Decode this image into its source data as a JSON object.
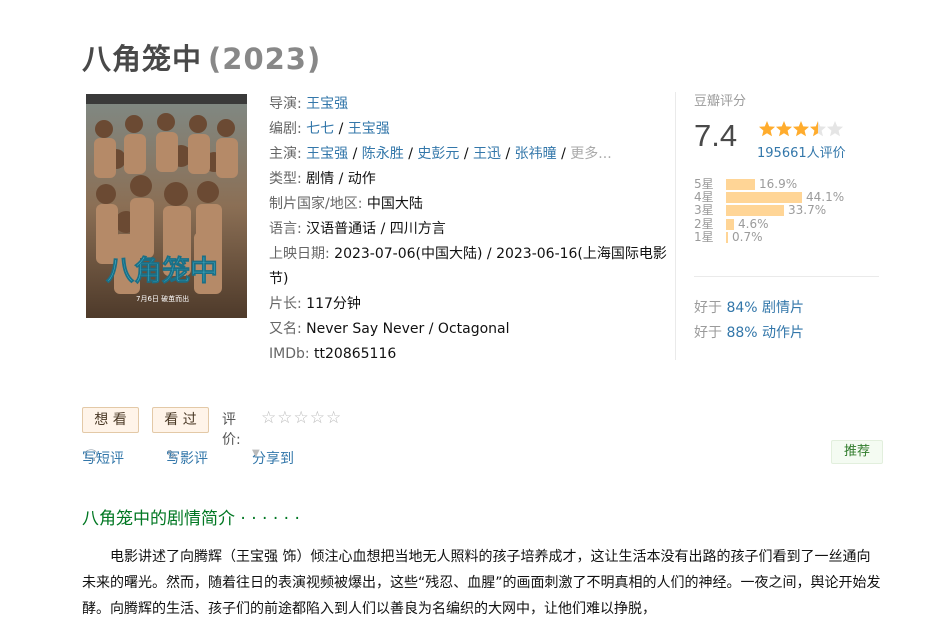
{
  "movie": {
    "title": "八角笼中",
    "year": "(2023)"
  },
  "info": {
    "director": {
      "label": "导演:",
      "names": [
        "王宝强"
      ]
    },
    "writer": {
      "label": "编剧:",
      "names": [
        "七七",
        "王宝强"
      ]
    },
    "cast": {
      "label": "主演:",
      "names": [
        "王宝强",
        "陈永胜",
        "史彭元",
        "王迅",
        "张祎曈"
      ],
      "more": "更多..."
    },
    "genre": {
      "label": "类型:",
      "names": [
        "剧情",
        "动作"
      ]
    },
    "country": {
      "label": "制片国家/地区:",
      "value": "中国大陆"
    },
    "language": {
      "label": "语言:",
      "value": "汉语普通话 / 四川方言"
    },
    "release": {
      "label": "上映日期:",
      "value": "2023-07-06(中国大陆) / 2023-06-16(上海国际电影节)"
    },
    "runtime": {
      "label": "片长:",
      "value": "117分钟"
    },
    "aka": {
      "label": "又名:",
      "value": "Never Say Never / Octagonal"
    },
    "imdb": {
      "label": "IMDb:",
      "value": "tt20865116"
    }
  },
  "poster": {
    "caption": "八角笼中",
    "small_text": "7月6日 破茧而出"
  },
  "rating": {
    "label": "豆瓣评分",
    "score": "7.4",
    "stars": 3.5,
    "count": "195661人评价",
    "distribution": [
      {
        "label": "5星",
        "percent": "16.9%",
        "value": 16.9
      },
      {
        "label": "4星",
        "percent": "44.1%",
        "value": 44.1
      },
      {
        "label": "3星",
        "percent": "33.7%",
        "value": 33.7
      },
      {
        "label": "2星",
        "percent": "4.6%",
        "value": 4.6
      },
      {
        "label": "1星",
        "percent": "0.7%",
        "value": 0.7
      }
    ],
    "better_than": [
      {
        "prefix": "好于",
        "link": "84% 剧情片"
      },
      {
        "prefix": "好于",
        "link": "88% 动作片"
      }
    ]
  },
  "actions": {
    "want": "想 看",
    "seen": "看 过",
    "rate_label": "评价:",
    "rate_stars": "☆☆☆☆☆"
  },
  "ops": {
    "review_short": "写短评",
    "review_long": "写影评",
    "share": "分享到",
    "recommend": "推荐"
  },
  "section": {
    "title": "八角笼中的剧情简介 · · · · · ·",
    "summary": "电影讲述了向腾辉（王宝强 饰）倾注心血想把当地无人照料的孩子培养成才，这让生活本没有出路的孩子们看到了一丝通向未来的曙光。然而，随着往日的表演视频被爆出，这些“残忍、血腥”的画面刺激了不明真相的人们的神经。一夜之间，舆论开始发酵。向腾辉的生活、孩子们的前途都陷入到人们以善良为名编织的大网中，让他们难以挣脱，"
  },
  "colors": {
    "link": "#3377aa",
    "bar": "#ffd596",
    "star": "#ffac2d",
    "section_green": "#007722"
  }
}
